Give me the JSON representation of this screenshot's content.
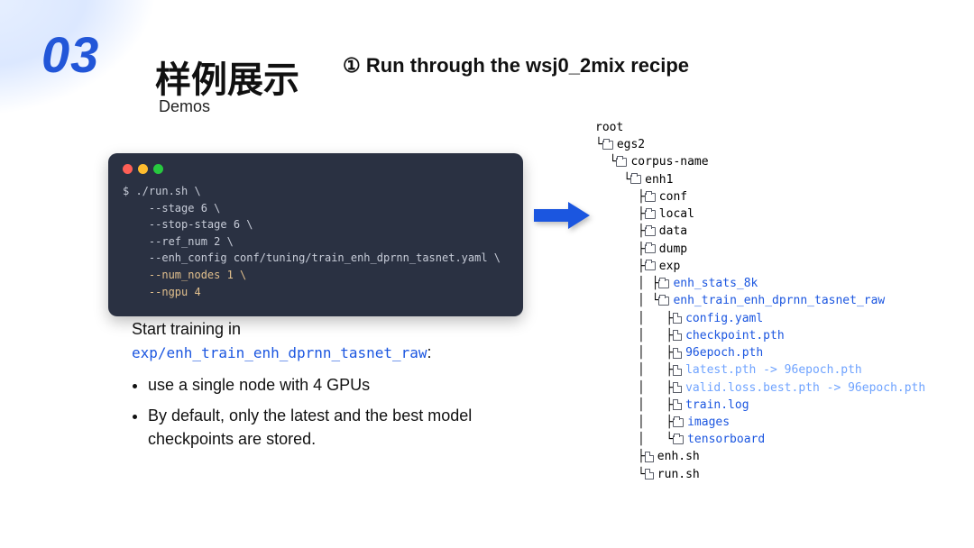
{
  "slide_number": "03",
  "title_cn": "样例展示",
  "title_sub": "Demos",
  "step_title_prefix": "①",
  "step_title": "Run through the wsj0_2mix recipe",
  "terminal": {
    "l1": "$ ./run.sh \\",
    "l2": "    --stage 6 \\",
    "l3": "    --stop-stage 6 \\",
    "l4": "    --ref_num 2 \\",
    "l5": "    --enh_config conf/tuning/train_enh_dprnn_tasnet.yaml \\",
    "l6": "    --num_nodes 1 \\",
    "l7": "    --ngpu 4"
  },
  "description": {
    "intro": "Start training in",
    "path": "exp/enh_train_enh_dprnn_tasnet_raw",
    "colon": ":",
    "bullet1": "use a single node with 4 GPUs",
    "bullet2": "By default, only the latest and the best model checkpoints are stored."
  },
  "tree": {
    "root": "root",
    "egs2": "egs2",
    "corpus": "corpus-name",
    "enh1": "enh1",
    "conf": "conf",
    "local": "local",
    "data": "data",
    "dump": "dump",
    "exp": "exp",
    "stats": "enh_stats_8k",
    "train": "enh_train_enh_dprnn_tasnet_raw",
    "config": "config.yaml",
    "checkpoint": "checkpoint.pth",
    "epoch96": "96epoch.pth",
    "latest": "latest.pth -> 96epoch.pth",
    "valid": "valid.loss.best.pth -> 96epoch.pth",
    "trainlog": "train.log",
    "images": "images",
    "tensorboard": "tensorboard",
    "enhsh": "enh.sh",
    "runsh": "run.sh"
  }
}
